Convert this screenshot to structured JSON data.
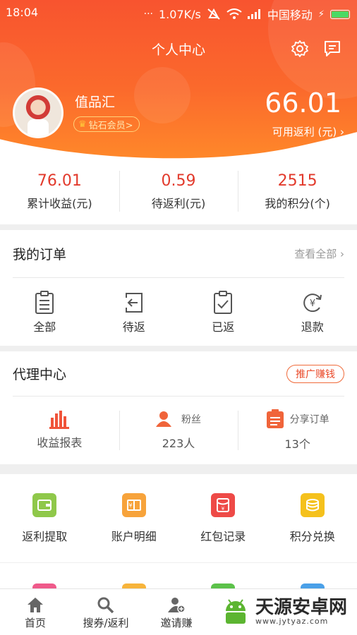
{
  "status_bar": {
    "time": "18:04",
    "speed": "1.07K/s",
    "carrier": "中国移动"
  },
  "header": {
    "title": "个人中心"
  },
  "profile": {
    "username": "值品汇",
    "vip_label": "钻石会员>",
    "balance": "66.01",
    "balance_label": "可用返利 (元) ›"
  },
  "stats": [
    {
      "value": "76.01",
      "label": "累计收益(元)"
    },
    {
      "value": "0.59",
      "label": "待返利(元)"
    },
    {
      "value": "2515",
      "label": "我的积分(个)"
    }
  ],
  "orders": {
    "title": "我的订单",
    "view_all": "查看全部 ›",
    "items": [
      {
        "label": "全部",
        "icon": "clipboard-list-icon"
      },
      {
        "label": "待返",
        "icon": "return-arrow-icon"
      },
      {
        "label": "已返",
        "icon": "clipboard-check-icon"
      },
      {
        "label": "退款",
        "icon": "yen-refund-icon"
      }
    ]
  },
  "agent": {
    "title": "代理中心",
    "promo_button": "推广赚钱",
    "items": [
      {
        "label": "收益报表",
        "icon": "bar-chart-icon"
      },
      {
        "title": "粉丝",
        "value": "223人",
        "icon": "fans-icon"
      },
      {
        "title": "分享订单",
        "value": "13个",
        "icon": "share-order-icon"
      }
    ]
  },
  "tools": [
    {
      "label": "返利提取",
      "icon": "wallet-icon",
      "color": "#8fc84a"
    },
    {
      "label": "账户明细",
      "icon": "account-detail-icon",
      "color": "#f7a33b"
    },
    {
      "label": "红包记录",
      "icon": "red-packet-icon",
      "color": "#ee4a47"
    },
    {
      "label": "积分兑换",
      "icon": "coins-icon",
      "color": "#f5c11c"
    }
  ],
  "tabbar": [
    {
      "label": "首页",
      "icon": "home-icon"
    },
    {
      "label": "搜券/返利",
      "icon": "search-icon"
    },
    {
      "label": "邀请赚",
      "icon": "invite-user-icon"
    }
  ],
  "watermark": {
    "name": "天源安卓网",
    "url": "www.jytyaz.com"
  },
  "colors": {
    "brand": "#f8542f",
    "accent_red": "#e23a2c"
  }
}
